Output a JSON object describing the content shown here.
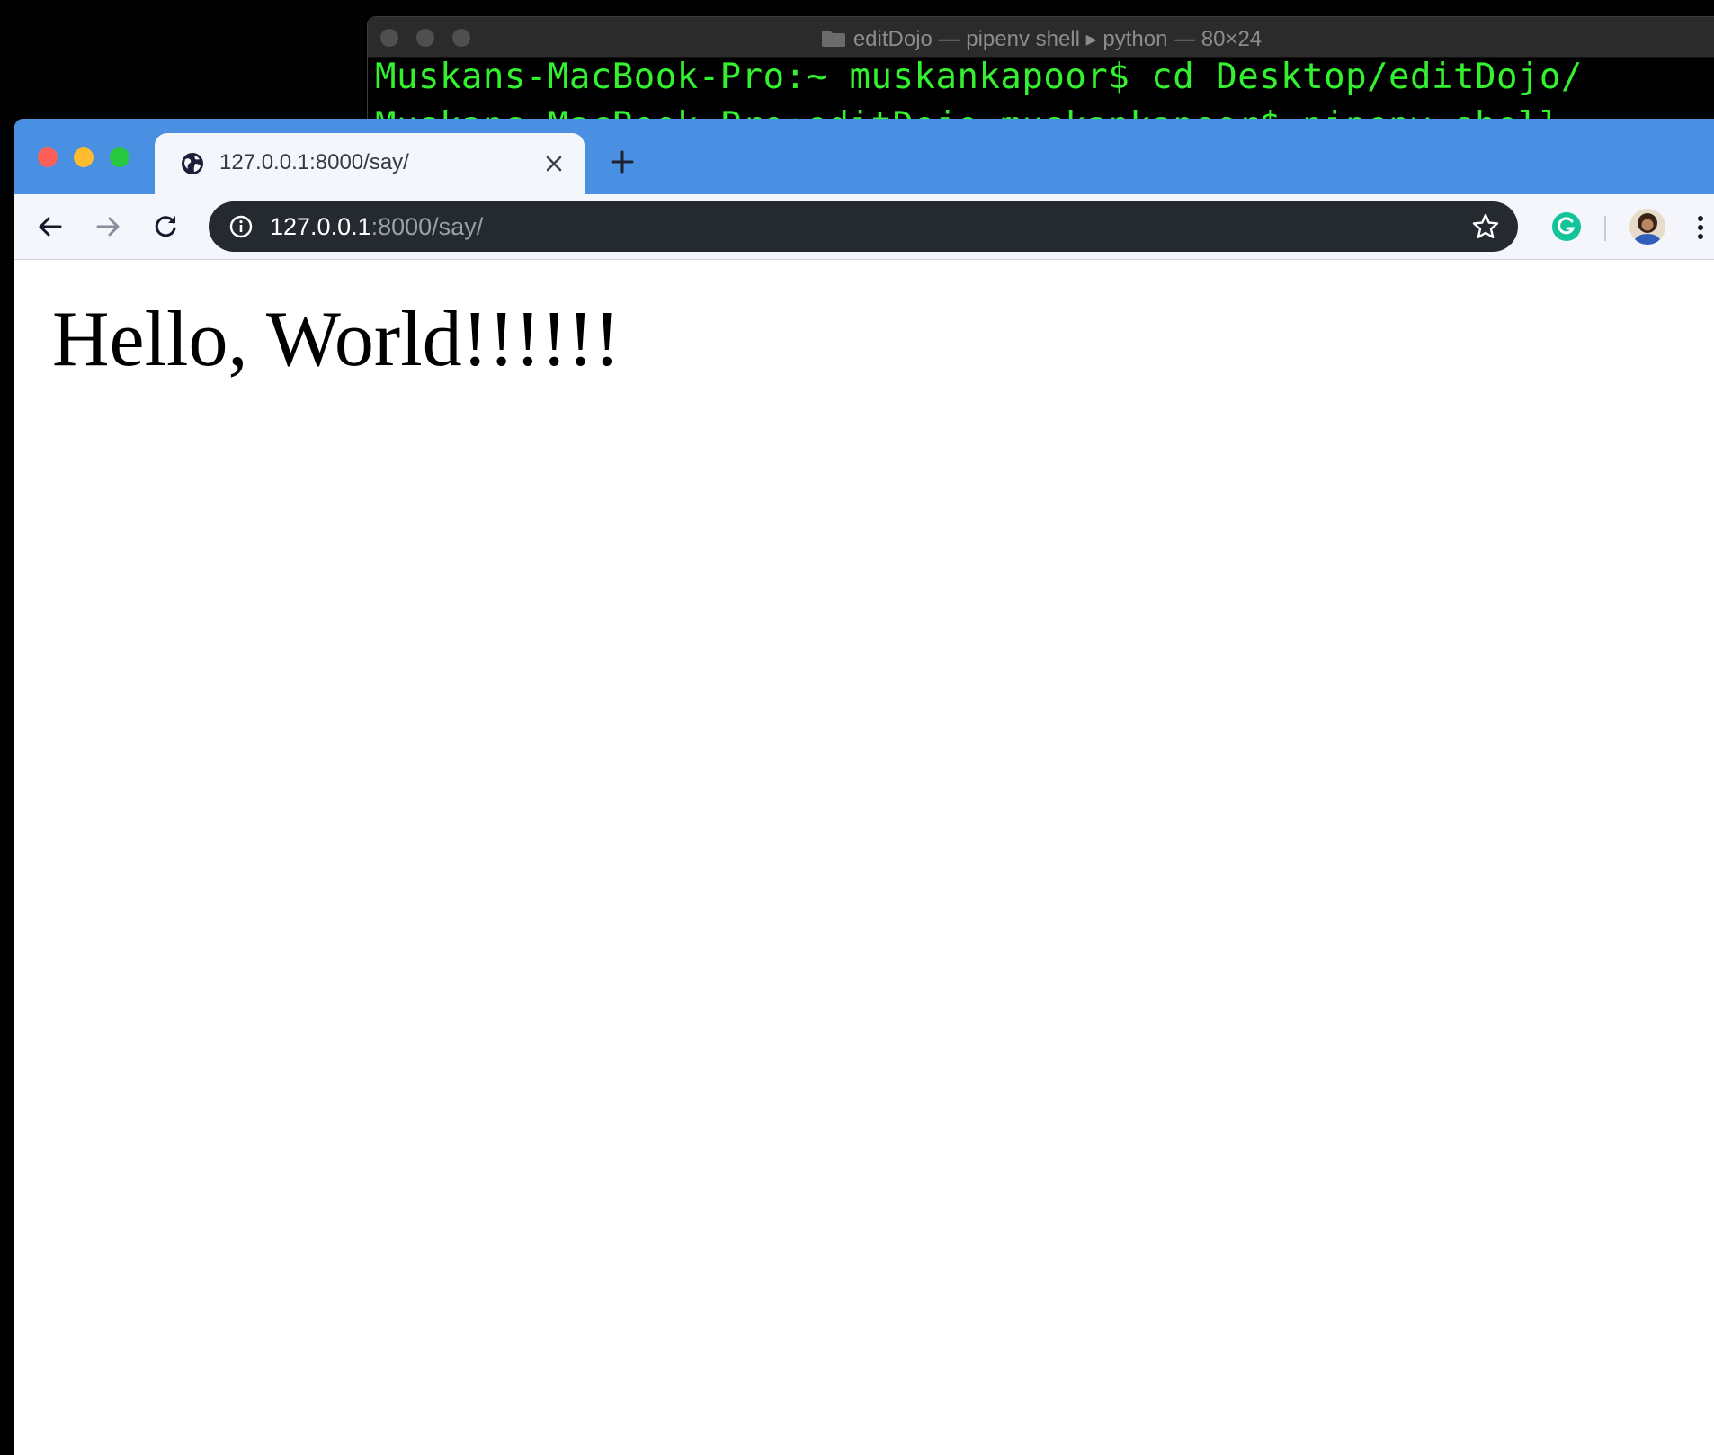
{
  "terminal": {
    "title": "editDojo — pipenv shell ▸ python — 80×24",
    "lines": [
      "Muskans-MacBook-Pro:~ muskankapoor$ cd Desktop/editDojo/",
      "Muskans-MacBook-Pro:editDojo muskankapoor$ pipenv shell"
    ],
    "text_color": "#33f12f"
  },
  "browser": {
    "tab": {
      "title": "127.0.0.1:8000/say/",
      "favicon": "globe-icon"
    },
    "address_bar": {
      "url_host": "127.0.0.1",
      "url_rest": ":8000/say/"
    },
    "accent_color": "#4a90e2",
    "extensions": [
      "grammarly-icon"
    ]
  },
  "page": {
    "heading": "Hello, World!!!!!!"
  }
}
